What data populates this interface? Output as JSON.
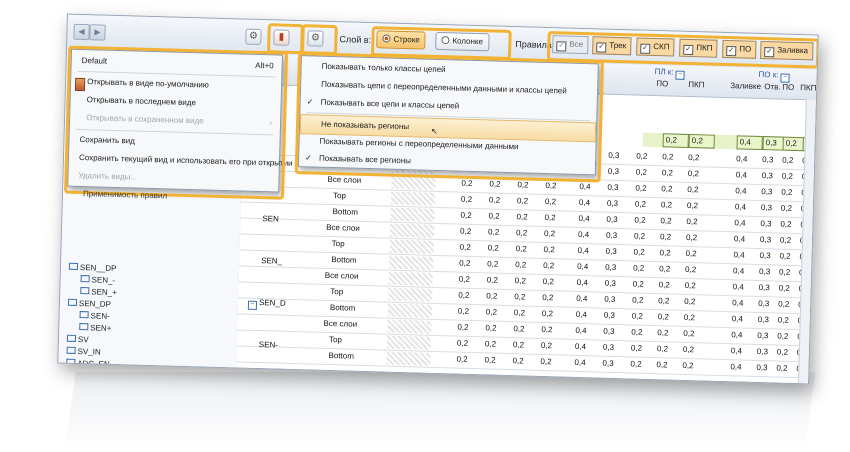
{
  "toolbar": {
    "layer_label": "Слой в:",
    "row_option": "Строке",
    "column_option": "Колонке",
    "rules_label": "Правила:",
    "filters": [
      {
        "label": "Все",
        "checked": true,
        "style": "plain"
      },
      {
        "label": "Трек",
        "checked": true
      },
      {
        "label": "СКП",
        "checked": true
      },
      {
        "label": "ПКП",
        "checked": true
      },
      {
        "label": "ПО",
        "checked": true
      },
      {
        "label": "Заливка",
        "checked": true
      }
    ]
  },
  "view_menu": {
    "items": [
      {
        "label": "Default",
        "shortcut": "Alt+0"
      },
      {
        "label": "Открывать в виде по-умолчанию"
      },
      {
        "label": "Открывать в последнем виде"
      },
      {
        "label": "Открывать в сохраненном виде",
        "disabled": true
      },
      {
        "label": "Сохранить вид"
      },
      {
        "label": "Сохранить текущий вид и использовать его при открытии"
      },
      {
        "label": "Удалить виды...",
        "disabled": true
      }
    ],
    "peek": "Применимость правил"
  },
  "display_menu": {
    "items": [
      {
        "label": "Показывать только классы цепей"
      },
      {
        "label": "Показывать цепи с переопределенными данными и классы цепей"
      },
      {
        "label": "Показывать все цепи и классы цепей",
        "checked": true
      },
      {
        "label": "Не показывать регионы",
        "hover": true
      },
      {
        "label": "Показывать регионы с переопределенными данными"
      },
      {
        "label": "Показывать все регионы",
        "checked": true
      }
    ]
  },
  "tree": {
    "items": [
      "SEN__DP",
      "SEN_-",
      "SEN_+",
      "SEN_DP",
      "SEN-",
      "SEN+",
      "SV",
      "SV_IN",
      "ADC_EN"
    ]
  },
  "grid": {
    "group_labels": [
      "ПЛ к:",
      "ПО к:"
    ],
    "headers": [
      "ПО",
      "ПКП",
      "Заливке",
      "Отв.",
      "ПО",
      "ПКП"
    ],
    "row_names": [
      "Top",
      "Bottom",
      "Все слои",
      "Top",
      "Bottom",
      "Все слои",
      "Top",
      "Bottom",
      "Все слои",
      "Top",
      "Bottom",
      "Все слои",
      "Top",
      "Bottom"
    ],
    "net_labels": [
      "SEN",
      "SEN_",
      "SEN_D",
      "SEN-"
    ],
    "values": [
      "0,2",
      "0,2",
      "0,2",
      "0,2",
      "0,4",
      "0,3",
      "0,2",
      "0,2",
      "0,2",
      "0,4",
      "0,3",
      "0,2",
      "0,2"
    ],
    "header_row_values": [
      "0,2",
      "0,2",
      "0,4",
      "0,3",
      "0,2",
      "0,2"
    ]
  }
}
